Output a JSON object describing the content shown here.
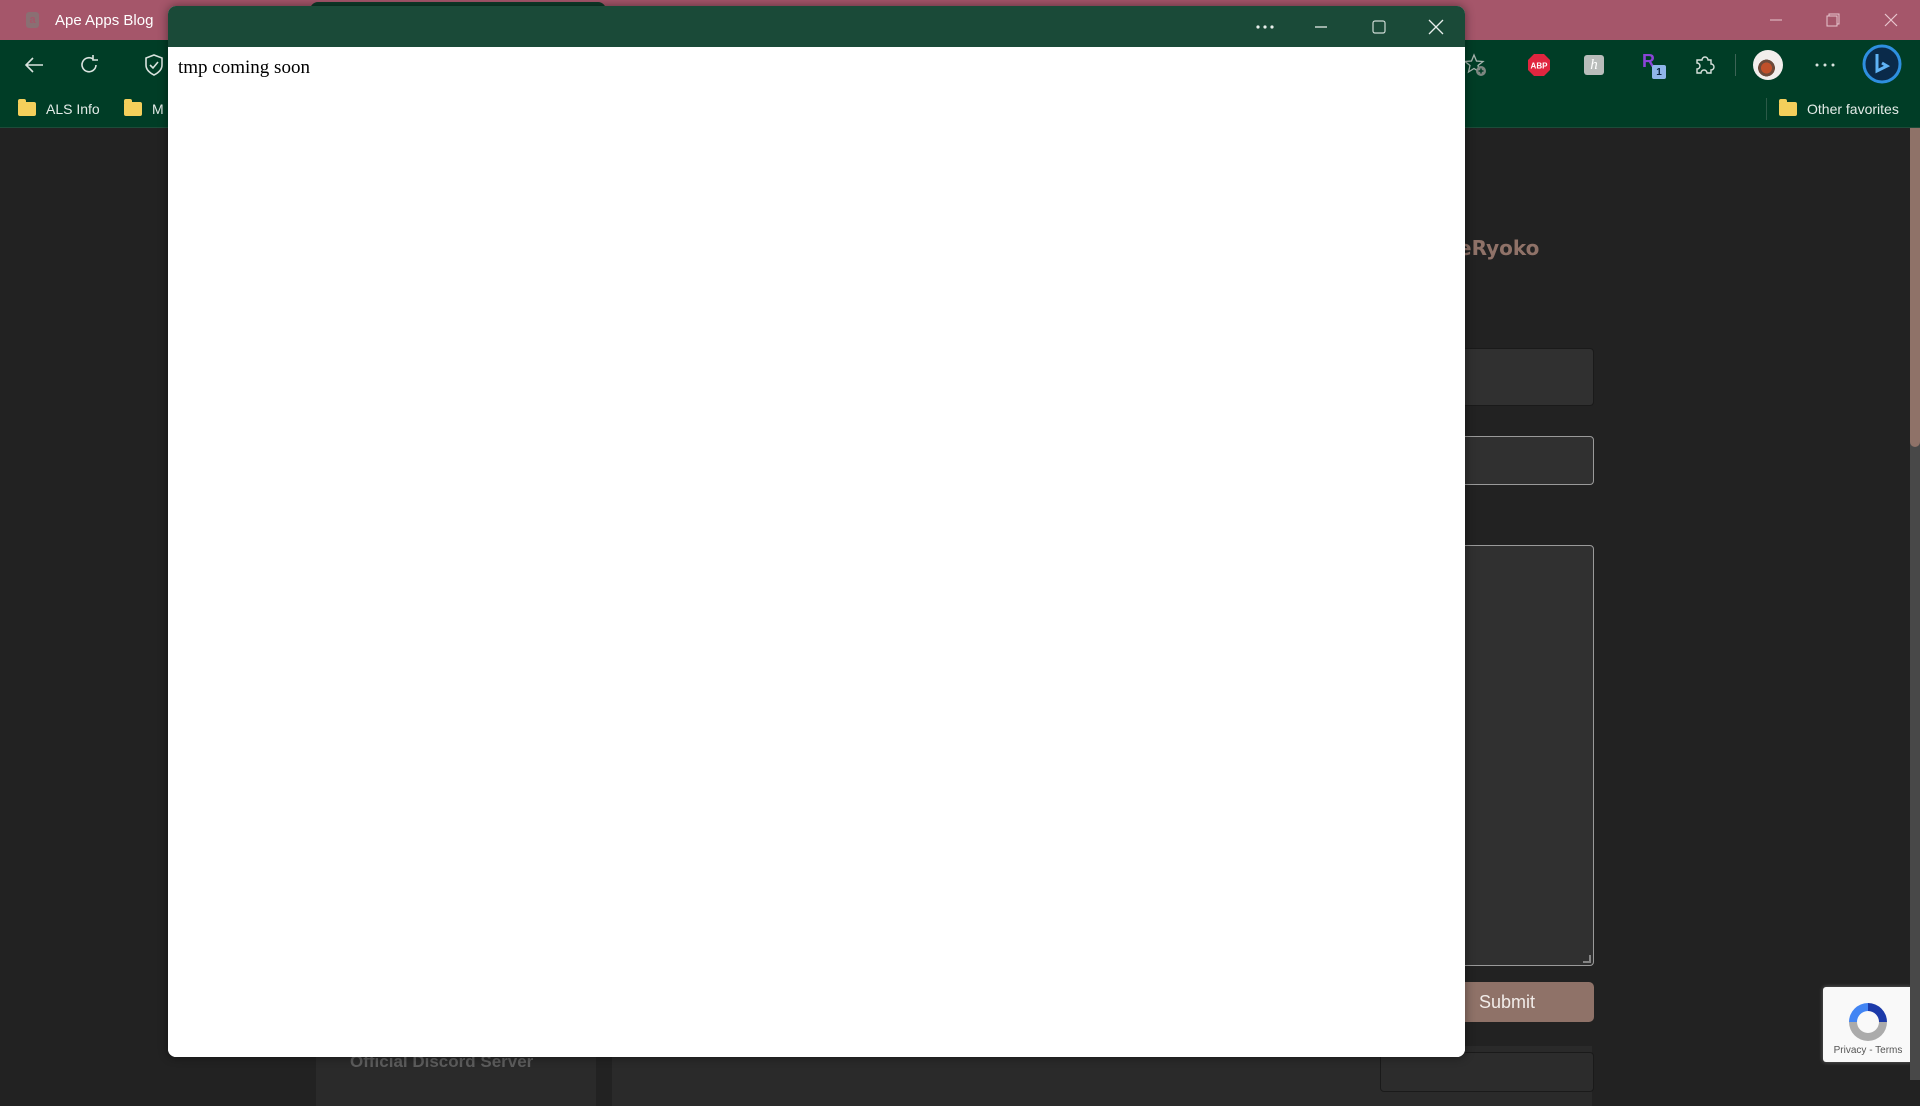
{
  "browser": {
    "tabs": [
      {
        "label": "Ape Apps Blog",
        "favicon": "a",
        "active": true
      },
      {
        "label": "",
        "active": false
      }
    ],
    "window_controls": {
      "minimize": "minimize-icon",
      "restore": "restore-icon",
      "close": "close-icon"
    },
    "toolbar": {
      "left_icons": [
        "back-arrow-icon",
        "refresh-icon",
        "shield-check-icon"
      ],
      "right_icons": [
        "favorite-add-icon",
        "adblock-plus-extension-icon",
        "honey-extension-icon",
        "r-extension-icon",
        "extensions-puzzle-icon",
        "profile-avatar",
        "more-options-icon",
        "bing-copilot-icon"
      ],
      "abp_label": "ABP",
      "h_ext_label": "h",
      "r_ext_label": "R",
      "r_ext_badge": "1"
    },
    "favorites": [
      {
        "label": "ALS Info"
      },
      {
        "label": "M"
      }
    ],
    "other_favorites": "Other favorites"
  },
  "page": {
    "username": "ePirateRyoko",
    "submit_label": "Submit",
    "left_card_text": "Official Discord Server",
    "recaptcha_text": "Privacy - Terms",
    "accent_color": "#8f7268"
  },
  "popup": {
    "body_text": "tmp coming soon",
    "titlebar_color": "#1a4a38"
  }
}
